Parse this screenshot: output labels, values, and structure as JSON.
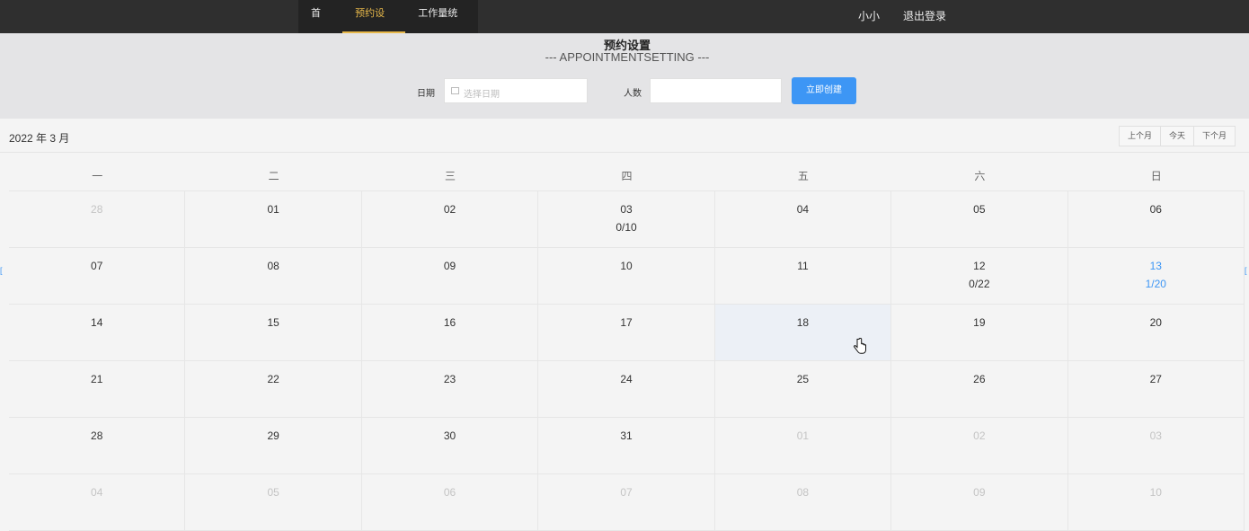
{
  "nav": {
    "items": [
      {
        "label": "首页",
        "active": false
      },
      {
        "label": "预约设置",
        "active": true
      },
      {
        "label": "工作量统计",
        "active": false
      }
    ],
    "user": "小小",
    "logout": "退出登录"
  },
  "header": {
    "title": "预约设置",
    "subtitle": "--- APPOINTMENTSETTING ---",
    "date_label": "日期",
    "date_placeholder": "选择日期",
    "count_label": "人数",
    "create_button": "立即创建"
  },
  "calendar": {
    "month_label": "2022 年 3 月",
    "buttons": {
      "prev": "上个月",
      "today": "今天",
      "next": "下个月"
    },
    "weekdays": [
      "一",
      "二",
      "三",
      "四",
      "五",
      "六",
      "日"
    ],
    "rows": [
      [
        {
          "day": "28",
          "other": true
        },
        {
          "day": "01"
        },
        {
          "day": "02"
        },
        {
          "day": "03",
          "info": "0/10"
        },
        {
          "day": "04"
        },
        {
          "day": "05"
        },
        {
          "day": "06"
        }
      ],
      [
        {
          "day": "07"
        },
        {
          "day": "08"
        },
        {
          "day": "09"
        },
        {
          "day": "10"
        },
        {
          "day": "11"
        },
        {
          "day": "12",
          "info": "0/22"
        },
        {
          "day": "13",
          "info": "1/20",
          "highlight": true
        }
      ],
      [
        {
          "day": "14"
        },
        {
          "day": "15"
        },
        {
          "day": "16"
        },
        {
          "day": "17"
        },
        {
          "day": "18",
          "selected": true
        },
        {
          "day": "19"
        },
        {
          "day": "20"
        }
      ],
      [
        {
          "day": "21"
        },
        {
          "day": "22"
        },
        {
          "day": "23"
        },
        {
          "day": "24"
        },
        {
          "day": "25"
        },
        {
          "day": "26"
        },
        {
          "day": "27"
        }
      ],
      [
        {
          "day": "28"
        },
        {
          "day": "29"
        },
        {
          "day": "30"
        },
        {
          "day": "31"
        },
        {
          "day": "01",
          "other": true
        },
        {
          "day": "02",
          "other": true
        },
        {
          "day": "03",
          "other": true
        }
      ],
      [
        {
          "day": "04",
          "other": true
        },
        {
          "day": "05",
          "other": true
        },
        {
          "day": "06",
          "other": true
        },
        {
          "day": "07",
          "other": true
        },
        {
          "day": "08",
          "other": true
        },
        {
          "day": "09",
          "other": true
        },
        {
          "day": "10",
          "other": true
        }
      ]
    ]
  },
  "colors": {
    "accent": "#3d96f5",
    "nav_active": "#e7b84a",
    "topbar": "#2f2f2f"
  }
}
